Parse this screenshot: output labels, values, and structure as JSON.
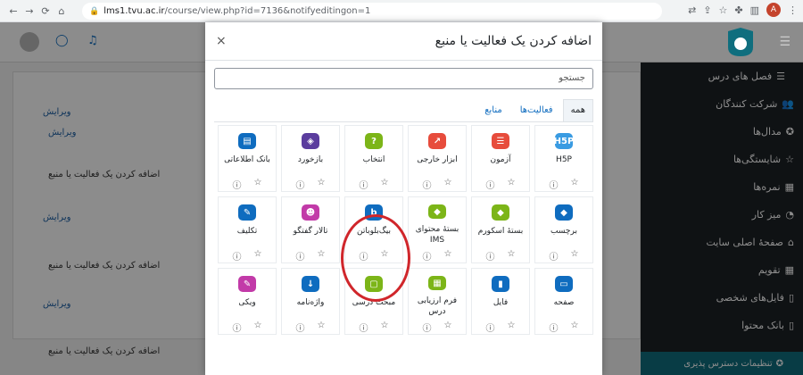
{
  "browser": {
    "url_host": "lms1.tvu.ac.ir",
    "url_path": "/course/view.php?id=7136&notifyeditingon=1",
    "profile_letter": "A"
  },
  "drawer": {
    "items": [
      {
        "label": "فصل های درس"
      },
      {
        "label": "شرکت کنندگان"
      },
      {
        "label": "مدال‌ها"
      },
      {
        "label": "شایستگی‌ها"
      },
      {
        "label": "نمره‌ها"
      },
      {
        "label": "میز کار"
      },
      {
        "label": "صفحهٔ اصلی سایت"
      },
      {
        "label": "تقویم"
      },
      {
        "label": "فایل‌های شخصی"
      },
      {
        "label": "بانک محتوا"
      }
    ],
    "accessibility": "تنظیمات دسترس پذیری"
  },
  "left": {
    "edit": "ویرایش",
    "add": "اضافه کردن یک فعالیت یا منبع"
  },
  "modal": {
    "title": "اضافه کردن یک فعالیت یا منبع",
    "close": "×",
    "search_placeholder": "جستجو",
    "tabs": [
      "همه",
      "فعالیت‌ها",
      "منابع"
    ],
    "tiles": [
      {
        "name": "H5P",
        "icon_text": "H5P",
        "color": "#399be2"
      },
      {
        "name": "آزمون",
        "icon_text": "☰",
        "color": "#e74c3c"
      },
      {
        "name": "ابزار خارجی",
        "icon_text": "↗",
        "color": "#e74c3c"
      },
      {
        "name": "انتخاب",
        "icon_text": "?",
        "color": "#7cb518"
      },
      {
        "name": "بازخورد",
        "icon_text": "◈",
        "color": "#5b3d9e"
      },
      {
        "name": "بانک اطلاعاتی",
        "icon_text": "▤",
        "color": "#0f6cbf"
      },
      {
        "name": "برچسب",
        "icon_text": "◆",
        "color": "#0f6cbf"
      },
      {
        "name": "بستهٔ اسکورم",
        "icon_text": "◆",
        "color": "#7cb518"
      },
      {
        "name": "بستهٔ محتوای IMS",
        "icon_text": "◆",
        "color": "#7cb518"
      },
      {
        "name": "بیگ‌بلوباتن",
        "icon_text": "b",
        "color": "#0f6cbf"
      },
      {
        "name": "تالار گفتگو",
        "icon_text": "☻",
        "color": "#c23aa8"
      },
      {
        "name": "تکلیف",
        "icon_text": "✎",
        "color": "#0f6cbf"
      },
      {
        "name": "صفحه",
        "icon_text": "▭",
        "color": "#0f6cbf"
      },
      {
        "name": "فایل",
        "icon_text": "▮",
        "color": "#0f6cbf"
      },
      {
        "name": "فرم ارزیابی درس",
        "icon_text": "▦",
        "color": "#7cb518"
      },
      {
        "name": "مبحث درسی",
        "icon_text": "▢",
        "color": "#7cb518"
      },
      {
        "name": "واژه‌نامه",
        "icon_text": "↓",
        "color": "#0f6cbf"
      },
      {
        "name": "ویکی",
        "icon_text": "✎",
        "color": "#c23aa8"
      }
    ]
  }
}
